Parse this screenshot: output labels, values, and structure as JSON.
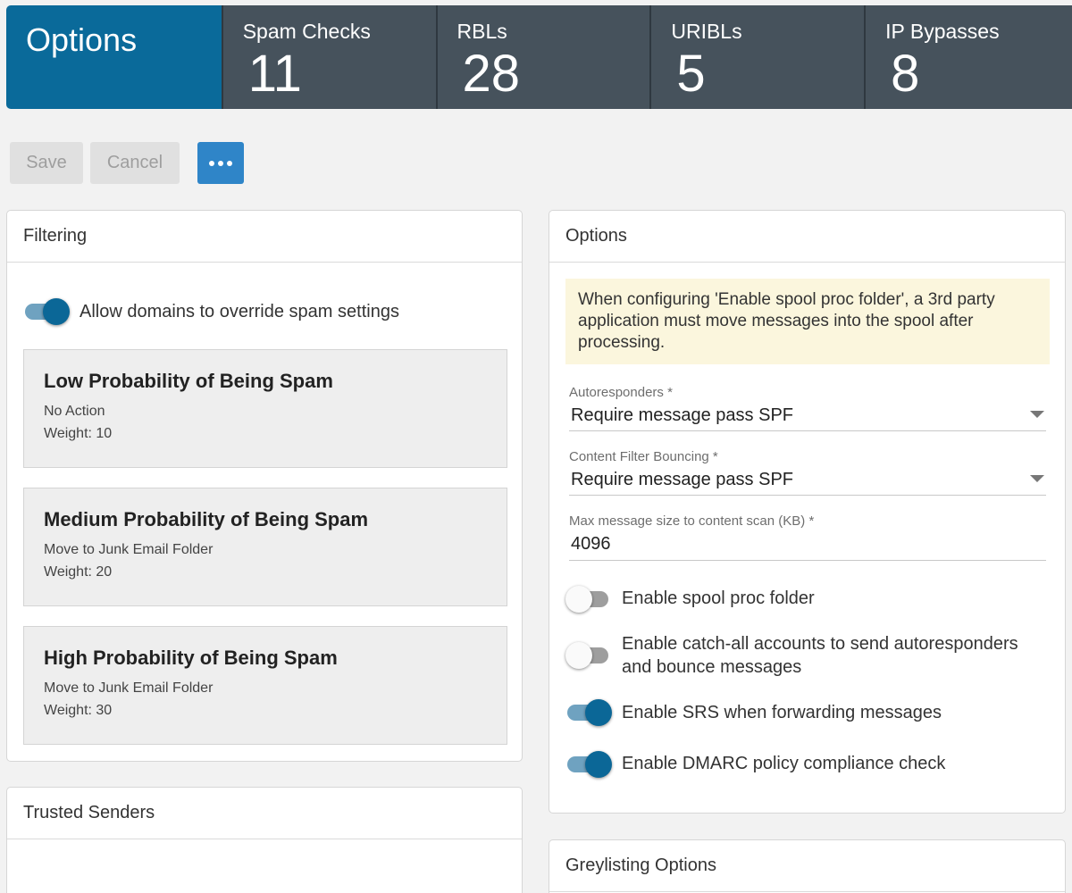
{
  "tabs": {
    "options_title": "Options",
    "stats": [
      {
        "label": "Spam Checks",
        "value": "11"
      },
      {
        "label": "RBLs",
        "value": "28"
      },
      {
        "label": "URIBLs",
        "value": "5"
      },
      {
        "label": "IP Bypasses",
        "value": "8"
      }
    ]
  },
  "toolbar": {
    "save_label": "Save",
    "cancel_label": "Cancel",
    "more_icon": "more-horizontal-icon"
  },
  "filtering": {
    "title": "Filtering",
    "allow_override": {
      "label": "Allow domains to override spam settings",
      "on": true
    },
    "levels": [
      {
        "title": "Low Probability of Being Spam",
        "action": "No Action",
        "weight": "Weight: 10"
      },
      {
        "title": "Medium Probability of Being Spam",
        "action": "Move to Junk Email Folder",
        "weight": "Weight: 20"
      },
      {
        "title": "High Probability of Being Spam",
        "action": "Move to Junk Email Folder",
        "weight": "Weight: 30"
      }
    ]
  },
  "trusted_senders": {
    "title": "Trusted Senders"
  },
  "options": {
    "title": "Options",
    "notice": "When configuring 'Enable spool proc folder', a 3rd party application must move messages into the spool after processing.",
    "autoresponders": {
      "label": "Autoresponders *",
      "value": "Require message pass SPF"
    },
    "content_filter_bouncing": {
      "label": "Content Filter Bouncing *",
      "value": "Require message pass SPF"
    },
    "max_message_size": {
      "label": "Max message size to content scan (KB) *",
      "value": "4096"
    },
    "toggles": [
      {
        "label": "Enable spool proc folder",
        "on": false
      },
      {
        "label": "Enable catch-all accounts to send autoresponders and bounce messages",
        "on": false
      },
      {
        "label": "Enable SRS when forwarding messages",
        "on": true
      },
      {
        "label": "Enable DMARC policy compliance check",
        "on": true
      }
    ]
  },
  "greylisting": {
    "title": "Greylisting Options"
  }
}
